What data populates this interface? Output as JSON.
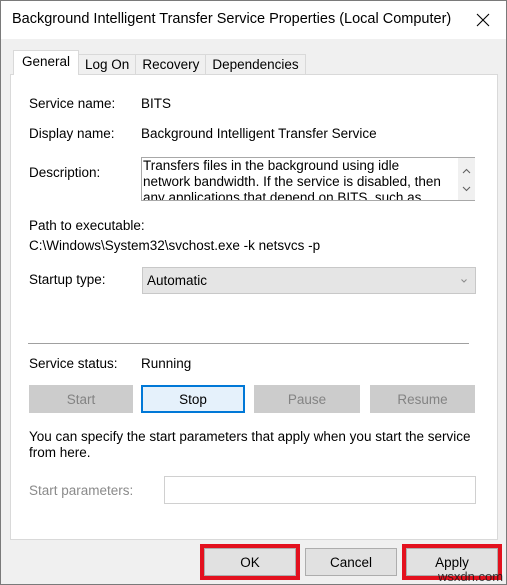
{
  "window": {
    "title": "Background Intelligent Transfer Service Properties (Local Computer)",
    "close_icon": "close-icon"
  },
  "tabs": [
    {
      "label": "General",
      "active": true
    },
    {
      "label": "Log On",
      "active": false
    },
    {
      "label": "Recovery",
      "active": false
    },
    {
      "label": "Dependencies",
      "active": false
    }
  ],
  "general": {
    "service_name_label": "Service name:",
    "service_name": "BITS",
    "display_name_label": "Display name:",
    "display_name": "Background Intelligent Transfer Service",
    "description_label": "Description:",
    "description": "Transfers files in the background using idle network bandwidth. If the service is disabled, then any applications that depend on BITS, such as Windows",
    "path_label": "Path to executable:",
    "path": "C:\\Windows\\System32\\svchost.exe -k netsvcs -p",
    "startup_type_label": "Startup type:",
    "startup_type": "Automatic",
    "service_status_label": "Service status:",
    "service_status": "Running",
    "buttons": {
      "start": "Start",
      "stop": "Stop",
      "pause": "Pause",
      "resume": "Resume"
    },
    "info_text": "You can specify the start parameters that apply when you start the service from here.",
    "start_params_label": "Start parameters:",
    "start_params_value": ""
  },
  "footer": {
    "ok": "OK",
    "cancel": "Cancel",
    "apply": "Apply"
  },
  "highlight_color": "#e3111e",
  "watermark": "wsxdn.com"
}
